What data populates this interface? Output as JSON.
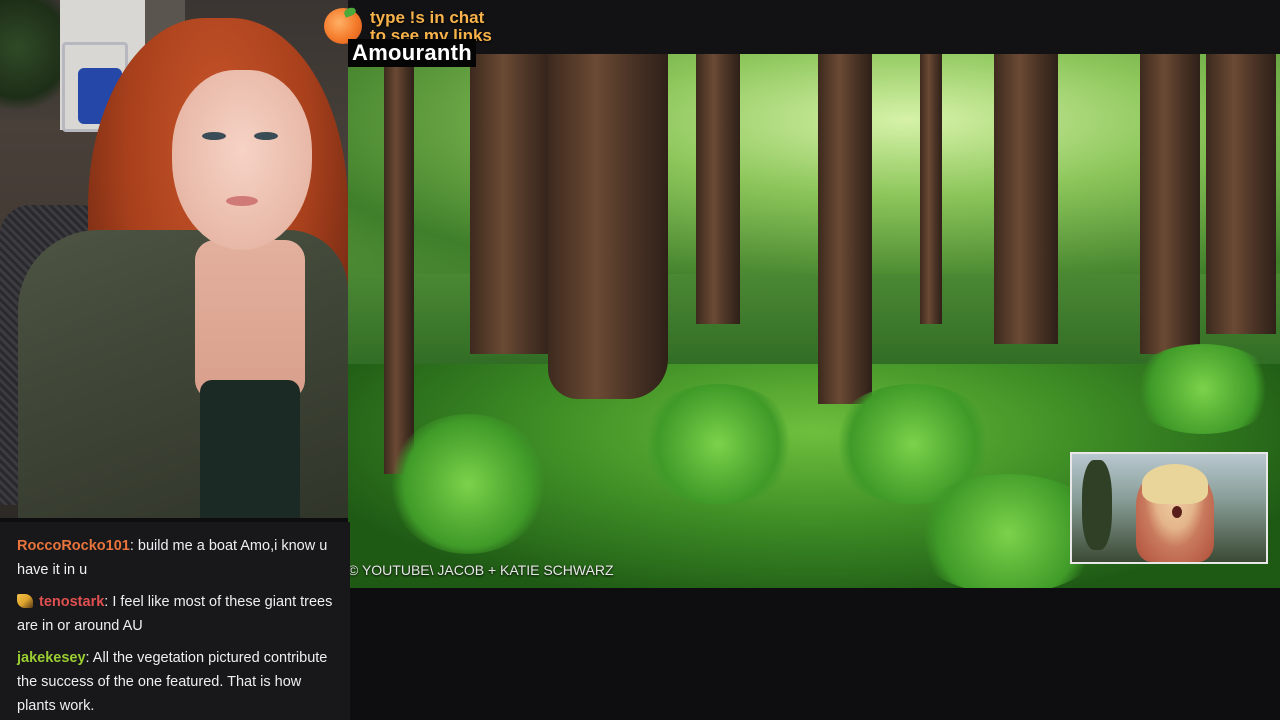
{
  "overlay": {
    "banner_line1": "type !s in chat",
    "banner_line2": "to see my links",
    "banner_icon": "peach-icon",
    "streamer_name": "Amouranth"
  },
  "video": {
    "credit": "© YOUTUBE\\ JACOB + KATIE SCHWARZ"
  },
  "chat": {
    "messages": [
      {
        "user": "RoccoRocko101",
        "user_color": "#e8743b",
        "text": ": build me a boat Amo,i know u have it in u",
        "badge": ""
      },
      {
        "user": "tenostark",
        "user_color": "#e05050",
        "text": ": I feel like most of these giant trees are in or around AU",
        "badge": "banana-badge-icon"
      },
      {
        "user": "jakekesey",
        "user_color": "#9acd32",
        "text": ": All the vegetation pictured contribute the success of the one featured. That is how plants work.",
        "badge": ""
      }
    ]
  },
  "colors": {
    "banner_text": "#f7b24a",
    "background": "#0e0e10",
    "chat_bg": "#18181b"
  }
}
